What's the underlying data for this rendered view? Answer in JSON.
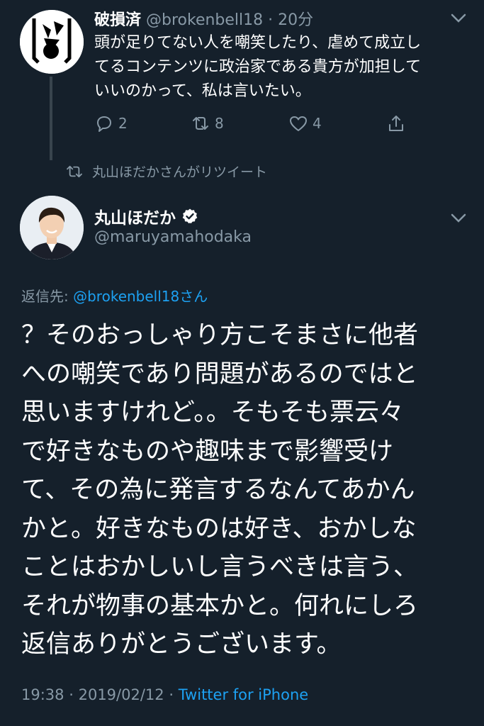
{
  "parent": {
    "name": "破損済",
    "handle": "@brokenbell18",
    "separator": "·",
    "time": "20分",
    "lines": [
      "頭が足りてない人を嘲笑したり、虐めて成立し",
      "てるコンテンツに政治家である貴方が加担して",
      "いいのかって、私は言いたい。"
    ],
    "reply_count": "2",
    "retweet_count": "8",
    "like_count": "4"
  },
  "retweeted_by": "丸山ほだかさんがリツイート",
  "tweet": {
    "name": "丸山ほだか",
    "handle": "@maruyamahodaka",
    "reply_prefix": "返信先: ",
    "reply_to": "@brokenbell18さん",
    "lines": [
      "？そのおっしゃり方こそまさに他者",
      "への嘲笑であり問題があるのではと",
      "思いますけれど。。そもそも票云々",
      "で好きなものや趣味まで影響受け",
      "て、その為に発言するなんてあかん",
      "かと。好きなものは好き、おかしな",
      "ことはおかしいし言うべきは言う、",
      "それが物事の基本かと。何れにしろ",
      "返信ありがとうございます。"
    ],
    "time": "19:38",
    "date": "2019/02/12",
    "separator": "·",
    "source": "Twitter for iPhone"
  },
  "colors": {
    "background": "#15202b",
    "secondary_text": "#8899a6",
    "link": "#1da1f2",
    "verified": "#ffffff"
  }
}
